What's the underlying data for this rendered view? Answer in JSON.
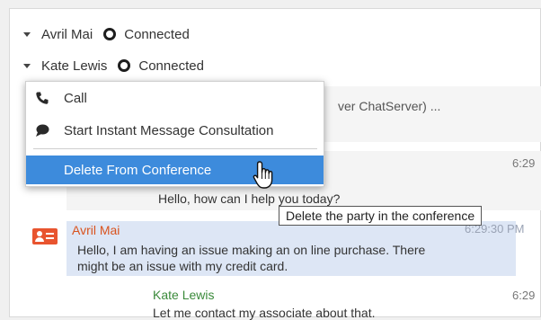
{
  "parties": [
    {
      "name": "Avril Mai",
      "status": "Connected"
    },
    {
      "name": "Kate Lewis",
      "status": "Connected"
    }
  ],
  "menu": {
    "items": [
      {
        "label": "Call",
        "icon": "phone-icon"
      },
      {
        "label": "Start Instant Message Consultation",
        "icon": "chat-bubble-icon"
      },
      {
        "label": "Delete From Conference",
        "icon": "",
        "highlighted": true
      }
    ],
    "highlight_color": "#3d8bdc"
  },
  "tooltip": "Delete the party in the conference",
  "transcript": {
    "system_message_fragment": "ver ChatServer) ...",
    "messages": [
      {
        "text": "Hello, how can I help you today?",
        "time": "6:29"
      },
      {
        "sender": "Avril Mai",
        "text_line1": "Hello, I am having an issue making an on line purchase. There",
        "text_line2": "might be an issue with my credit card.",
        "time": "6:29:30 PM",
        "sender_color": "#d9531e"
      },
      {
        "sender": "Kate Lewis",
        "text": "Let me contact my associate about that.",
        "time": "6:29",
        "sender_color": "#3a8a3a"
      }
    ]
  }
}
